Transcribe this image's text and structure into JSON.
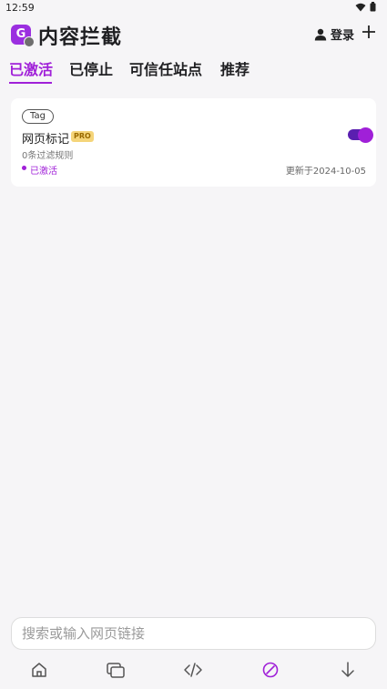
{
  "status_bar": {
    "time": "12:59",
    "icons": [
      "wifi-icon",
      "battery-icon"
    ]
  },
  "header": {
    "logo_letter": "G",
    "title": "内容拦截",
    "login_label": "登录",
    "icons": [
      "person-icon",
      "plus-icon"
    ]
  },
  "tabs": [
    {
      "label": "已激活",
      "active": true
    },
    {
      "label": "已停止",
      "active": false
    },
    {
      "label": "可信任站点",
      "active": false
    },
    {
      "label": "推荐",
      "active": false
    }
  ],
  "rules": [
    {
      "tag": "Tag",
      "name": "网页标记",
      "badge": "PRO",
      "rule_count": "0条过滤规则",
      "status": "已激活",
      "updated": "更新于2024-10-05",
      "enabled": true
    }
  ],
  "search": {
    "placeholder": "搜索或输入网页链接",
    "value": ""
  },
  "bottom_nav": [
    "home-icon",
    "tabs-icon",
    "code-icon",
    "block-icon",
    "download-icon"
  ],
  "colors": {
    "accent": "#a020d8",
    "background": "#f6f5f7",
    "card": "#ffffff",
    "pro_badge": "#f5d57a"
  }
}
